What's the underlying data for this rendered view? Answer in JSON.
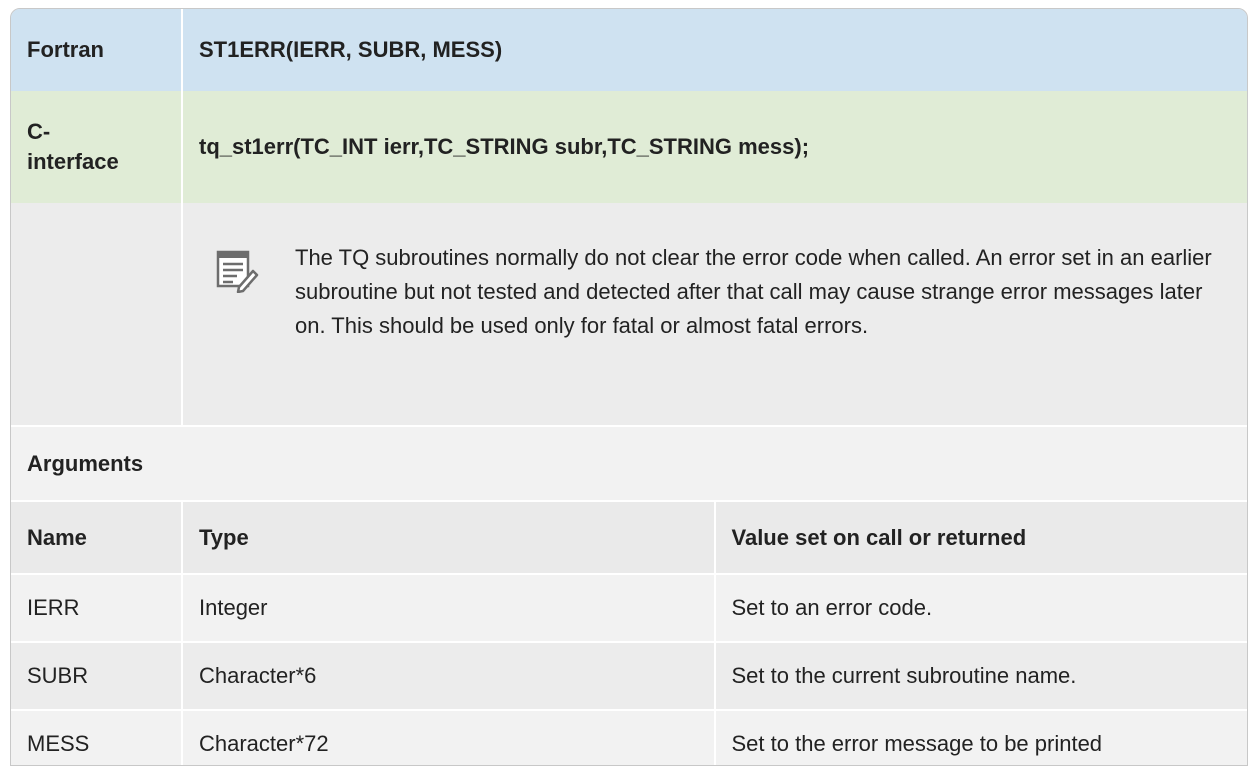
{
  "fortran": {
    "label": "Fortran",
    "signature": "ST1ERR(IERR, SUBR, MESS)"
  },
  "c_interface": {
    "label_line1": "C-",
    "label_line2": "interface",
    "signature": "tq_st1err(TC_INT ierr,TC_STRING subr,TC_STRING mess);"
  },
  "note": {
    "icon": "note-icon",
    "text": "The TQ subroutines normally do not clear the error code when called. An error set in an earlier subroutine but not tested and detected after that call may cause strange error messages later on. This should be used only for fatal or almost fatal errors."
  },
  "arguments": {
    "heading": "Arguments",
    "columns": [
      "Name",
      "Type",
      "Value set on call or returned"
    ],
    "rows": [
      {
        "name": "IERR",
        "type": "Integer",
        "value": "Set to an error code."
      },
      {
        "name": "SUBR",
        "type": "Character*6",
        "value": "Set to the current subroutine name."
      },
      {
        "name": "MESS",
        "type": "Character*72",
        "value": "Set to the error message to be printed"
      }
    ]
  }
}
